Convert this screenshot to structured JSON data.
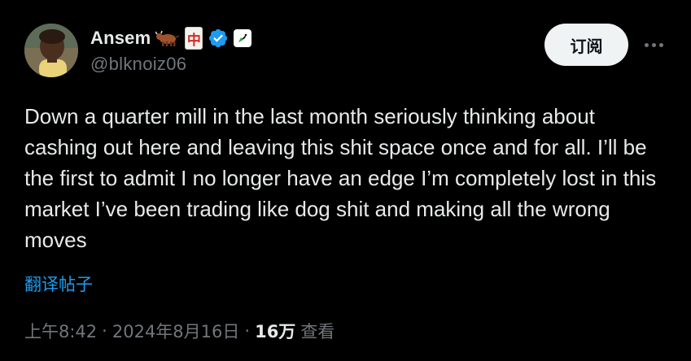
{
  "author": {
    "display_name": "Ansem",
    "handle": "@blknoiz06",
    "emoji_1": "🐂",
    "emoji_2": "🀄",
    "verified": true,
    "verified_color": "#1d9bf0",
    "affiliate_icon": "rocket-icon"
  },
  "actions": {
    "subscribe_label": "订阅",
    "more_icon": "more-horizontal-icon"
  },
  "post": {
    "text": "Down a quarter mill in the last month seriously thinking about cashing out here and leaving this shit space once and for all. I’ll be the first to admit I no longer have an edge I’m completely lost in this market I’ve been trading like dog shit and making all the wrong moves",
    "translate_label": "翻译帖子"
  },
  "meta": {
    "time": "上午8:42",
    "separator": "·",
    "date": "2024年8月16日",
    "views_count": "16万",
    "views_label": "查看"
  },
  "colors": {
    "background": "#000000",
    "text_primary": "#e7e9ea",
    "text_secondary": "#71767b",
    "link": "#1d9bf0",
    "button_bg": "#eff3f4"
  }
}
